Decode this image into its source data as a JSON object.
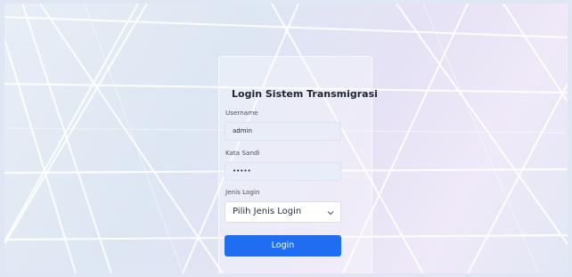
{
  "login": {
    "title": "Login Sistem Transmigrasi",
    "username_label": "Username",
    "username_value": "admin",
    "password_label": "Kata Sandi",
    "password_value": "•••••",
    "login_type_label": "Jenis Login",
    "login_type_value": "Pilih Jenis Login",
    "submit_label": "Login"
  },
  "colors": {
    "accent": "#1f6ef2"
  }
}
